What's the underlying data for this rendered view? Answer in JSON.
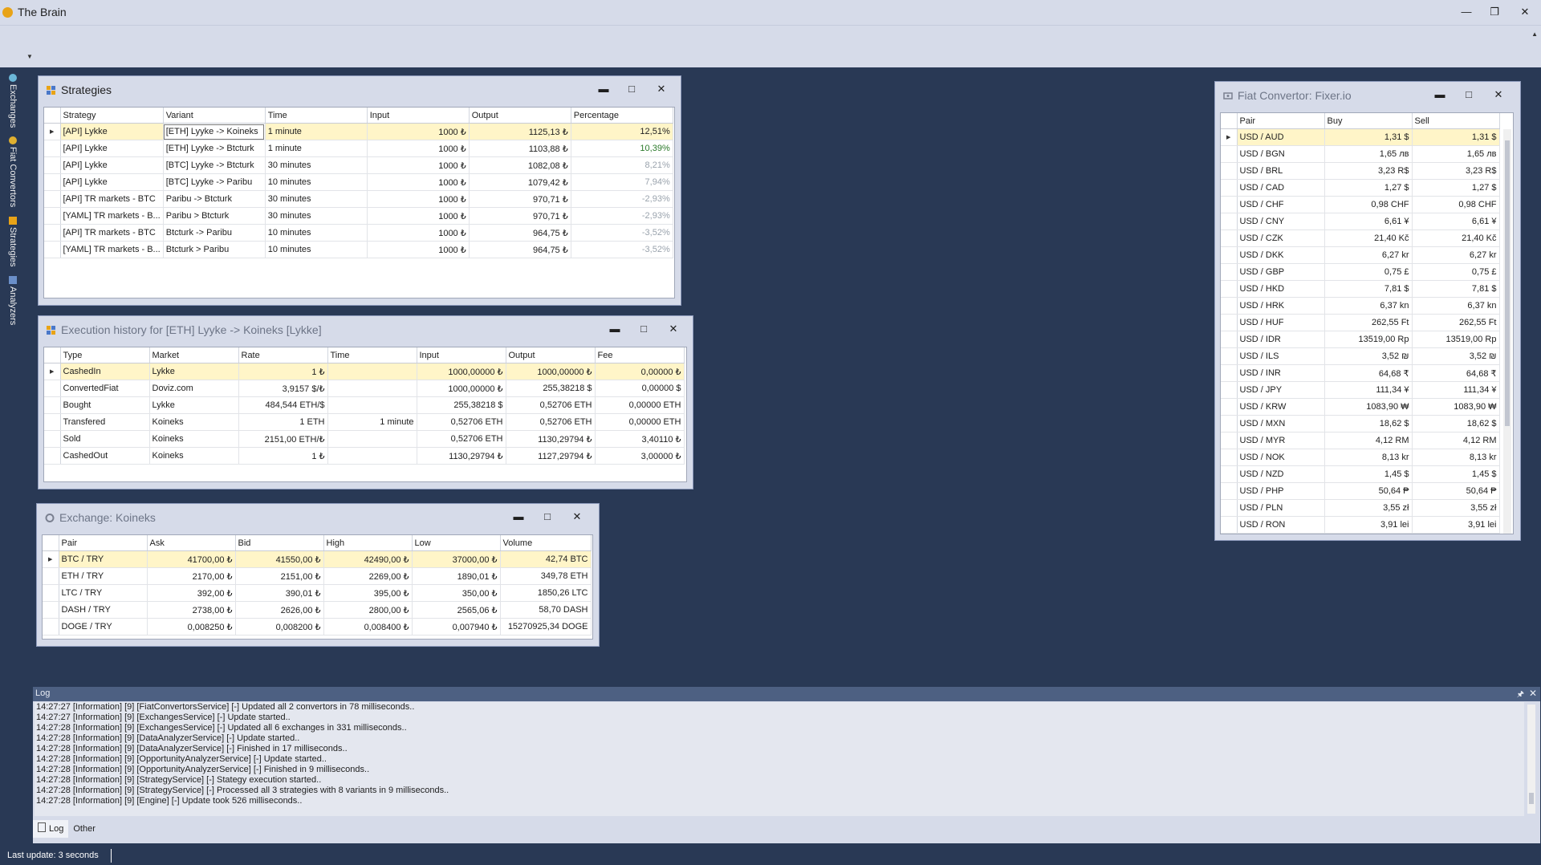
{
  "app": {
    "title": "The Brain"
  },
  "sidebar": {
    "items": [
      {
        "label": "Exchanges",
        "icon": "exchange-icon"
      },
      {
        "label": "Fiat Convertors",
        "icon": "coin-icon"
      },
      {
        "label": "Strategies",
        "icon": "strategy-icon"
      },
      {
        "label": "Analyzers",
        "icon": "chart-icon"
      }
    ]
  },
  "strategies": {
    "title": "Strategies",
    "columns": [
      "Strategy",
      "Variant",
      "Time",
      "Input",
      "Output",
      "Percentage"
    ],
    "rows": [
      [
        "[API] Lykke",
        "[ETH] Lyyke -> Koineks",
        "1 minute",
        "1000 ₺",
        "1125,13 ₺",
        "12,51%"
      ],
      [
        "[API] Lykke",
        "[ETH] Lyyke -> Btcturk",
        "1 minute",
        "1000 ₺",
        "1103,88 ₺",
        "10,39%"
      ],
      [
        "[API] Lykke",
        "[BTC] Lyyke -> Btcturk",
        "30 minutes",
        "1000 ₺",
        "1082,08 ₺",
        "8,21%"
      ],
      [
        "[API] Lykke",
        "[BTC] Lyyke -> Paribu",
        "10 minutes",
        "1000 ₺",
        "1079,42 ₺",
        "7,94%"
      ],
      [
        "[API] TR markets - BTC",
        "Paribu -> Btcturk",
        "30 minutes",
        "1000 ₺",
        "970,71 ₺",
        "-2,93%"
      ],
      [
        "[YAML] TR markets - B...",
        "Paribu > Btcturk",
        "30 minutes",
        "1000 ₺",
        "970,71 ₺",
        "-2,93%"
      ],
      [
        "[API] TR markets - BTC",
        "Btcturk -> Paribu",
        "10 minutes",
        "1000 ₺",
        "964,75 ₺",
        "-3,52%"
      ],
      [
        "[YAML] TR markets - B...",
        "Btcturk > Paribu",
        "10 minutes",
        "1000 ₺",
        "964,75 ₺",
        "-3,52%"
      ]
    ]
  },
  "execution": {
    "title": "Execution history for [ETH] Lyyke -> Koineks [Lykke]",
    "columns": [
      "Type",
      "Market",
      "Rate",
      "Time",
      "Input",
      "Output",
      "Fee"
    ],
    "rows": [
      [
        "CashedIn",
        "Lykke",
        "1 ₺",
        "",
        "1000,00000 ₺",
        "1000,00000 ₺",
        "0,00000 ₺"
      ],
      [
        "ConvertedFiat",
        "Doviz.com",
        "3,9157 $/₺",
        "",
        "1000,00000 ₺",
        "255,38218 $",
        "0,00000 $"
      ],
      [
        "Bought",
        "Lykke",
        "484,544 ETH/$",
        "",
        "255,38218 $",
        "0,52706 ETH",
        "0,00000 ETH"
      ],
      [
        "Transfered",
        "Koineks",
        "1 ETH",
        "1 minute",
        "0,52706 ETH",
        "0,52706 ETH",
        "0,00000 ETH"
      ],
      [
        "Sold",
        "Koineks",
        "2151,00 ETH/₺",
        "",
        "0,52706 ETH",
        "1130,29794 ₺",
        "3,40110 ₺"
      ],
      [
        "CashedOut",
        "Koineks",
        "1 ₺",
        "",
        "1130,29794 ₺",
        "1127,29794 ₺",
        "3,00000 ₺"
      ]
    ]
  },
  "exchange": {
    "title": "Exchange: Koineks",
    "columns": [
      "Pair",
      "Ask",
      "Bid",
      "High",
      "Low",
      "Volume"
    ],
    "rows": [
      [
        "BTC / TRY",
        "41700,00 ₺",
        "41550,00 ₺",
        "42490,00 ₺",
        "37000,00 ₺",
        "42,74 BTC"
      ],
      [
        "ETH / TRY",
        "2170,00 ₺",
        "2151,00 ₺",
        "2269,00 ₺",
        "1890,01 ₺",
        "349,78 ETH"
      ],
      [
        "LTC / TRY",
        "392,00 ₺",
        "390,01 ₺",
        "395,00 ₺",
        "350,00 ₺",
        "1850,26 LTC"
      ],
      [
        "DASH / TRY",
        "2738,00 ₺",
        "2626,00 ₺",
        "2800,00 ₺",
        "2565,06 ₺",
        "58,70 DASH"
      ],
      [
        "DOGE / TRY",
        "0,008250 ₺",
        "0,008200 ₺",
        "0,008400 ₺",
        "0,007940 ₺",
        "15270925,34 DOGE"
      ]
    ]
  },
  "fiat": {
    "title": "Fiat Convertor: Fixer.io",
    "columns": [
      "Pair",
      "Buy",
      "Sell"
    ],
    "rows": [
      [
        "USD / AUD",
        "1,31 $",
        "1,31 $"
      ],
      [
        "USD / BGN",
        "1,65 лв",
        "1,65 лв"
      ],
      [
        "USD / BRL",
        "3,23 R$",
        "3,23 R$"
      ],
      [
        "USD / CAD",
        "1,27 $",
        "1,27 $"
      ],
      [
        "USD / CHF",
        "0,98 CHF",
        "0,98 CHF"
      ],
      [
        "USD / CNY",
        "6,61 ¥",
        "6,61 ¥"
      ],
      [
        "USD / CZK",
        "21,40 Kč",
        "21,40 Kč"
      ],
      [
        "USD / DKK",
        "6,27 kr",
        "6,27 kr"
      ],
      [
        "USD / GBP",
        "0,75 £",
        "0,75 £"
      ],
      [
        "USD / HKD",
        "7,81 $",
        "7,81 $"
      ],
      [
        "USD / HRK",
        "6,37 kn",
        "6,37 kn"
      ],
      [
        "USD / HUF",
        "262,55 Ft",
        "262,55 Ft"
      ],
      [
        "USD / IDR",
        "13519,00 Rp",
        "13519,00 Rp"
      ],
      [
        "USD / ILS",
        "3,52 ₪",
        "3,52 ₪"
      ],
      [
        "USD / INR",
        "64,68 ₹",
        "64,68 ₹"
      ],
      [
        "USD / JPY",
        "111,34 ¥",
        "111,34 ¥"
      ],
      [
        "USD / KRW",
        "1083,90 ₩",
        "1083,90 ₩"
      ],
      [
        "USD / MXN",
        "18,62 $",
        "18,62 $"
      ],
      [
        "USD / MYR",
        "4,12 RM",
        "4,12 RM"
      ],
      [
        "USD / NOK",
        "8,13 kr",
        "8,13 kr"
      ],
      [
        "USD / NZD",
        "1,45 $",
        "1,45 $"
      ],
      [
        "USD / PHP",
        "50,64 ₱",
        "50,64 ₱"
      ],
      [
        "USD / PLN",
        "3,55 zł",
        "3,55 zł"
      ],
      [
        "USD / RON",
        "3,91 lei",
        "3,91 lei"
      ]
    ]
  },
  "log": {
    "title": "Log",
    "lines": [
      "14:27:27 [Information] [9] [FiatConvertorsService] [-] Updated all 2 convertors in 78 milliseconds..",
      "14:27:27 [Information] [9] [ExchangesService] [-] Update started..",
      "14:27:28 [Information] [9] [ExchangesService] [-] Updated all 6 exchanges in 331 milliseconds..",
      "14:27:28 [Information] [9] [DataAnalyzerService] [-] Update started..",
      "14:27:28 [Information] [9] [DataAnalyzerService] [-] Finished in 17 milliseconds..",
      "14:27:28 [Information] [9] [OpportunityAnalyzerService] [-] Update started..",
      "14:27:28 [Information] [9] [OpportunityAnalyzerService] [-] Finished in 9 milliseconds..",
      "14:27:28 [Information] [9] [StrategyService] [-] Stategy execution started..",
      "14:27:28 [Information] [9] [StrategyService] [-] Processed all 3 strategies with 8 variants in 9 milliseconds..",
      "14:27:28 [Information] [9] [Engine] [-] Update took 526 milliseconds.."
    ],
    "tabs": [
      "Log",
      "Other"
    ]
  },
  "status": {
    "text": "Last update: 3 seconds"
  }
}
